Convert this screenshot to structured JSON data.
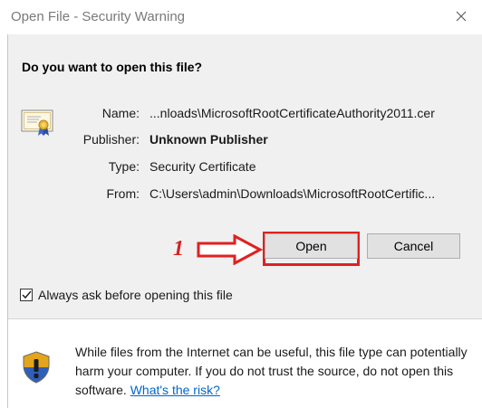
{
  "window": {
    "title": "Open File - Security Warning"
  },
  "dialog": {
    "question": "Do you want to open this file?",
    "fields": {
      "name_label": "Name:",
      "name_value": "...nloads\\MicrosoftRootCertificateAuthority2011.cer",
      "publisher_label": "Publisher:",
      "publisher_value": "Unknown Publisher",
      "type_label": "Type:",
      "type_value": "Security Certificate",
      "from_label": "From:",
      "from_value": "C:\\Users\\admin\\Downloads\\MicrosoftRootCertific..."
    },
    "buttons": {
      "open": "Open",
      "cancel": "Cancel"
    },
    "annotation": {
      "step_number": "1",
      "color": "#e02020"
    },
    "checkbox": {
      "label": "Always ask before opening this file",
      "checked": true
    }
  },
  "footer": {
    "warning_text": "While files from the Internet can be useful, this file type can potentially harm your computer. If you do not trust the source, do not open this software.",
    "risk_link": "What's the risk?"
  },
  "icons": {
    "certificate": "certificate-icon",
    "shield": "shield-warning-icon",
    "close": "close-icon",
    "checkmark": "checkmark-icon",
    "arrow": "annotation-arrow-icon"
  }
}
